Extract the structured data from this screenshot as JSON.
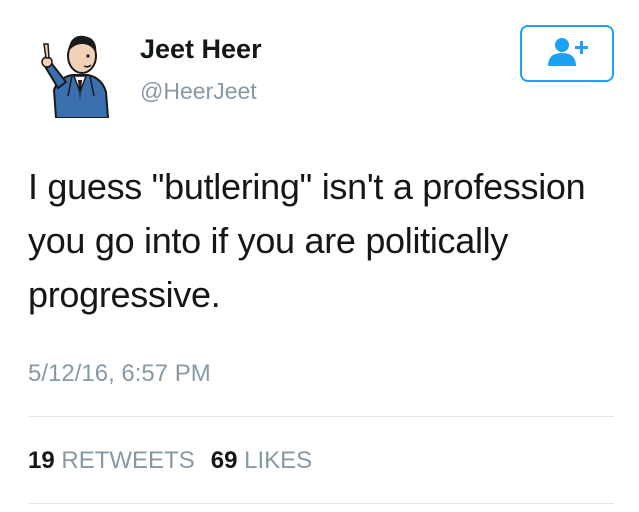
{
  "user": {
    "display_name": "Jeet Heer",
    "handle": "@HeerJeet"
  },
  "follow_button": {
    "icon": "add-user-icon",
    "color": "#1da1f2"
  },
  "tweet": {
    "text": "I guess \"butlering\" isn't a profession you go into if you are politically progressive.",
    "timestamp": "5/12/16, 6:57 PM"
  },
  "stats": {
    "retweets_count": "19",
    "retweets_label": "RETWEETS",
    "likes_count": "69",
    "likes_label": "LIKES"
  }
}
